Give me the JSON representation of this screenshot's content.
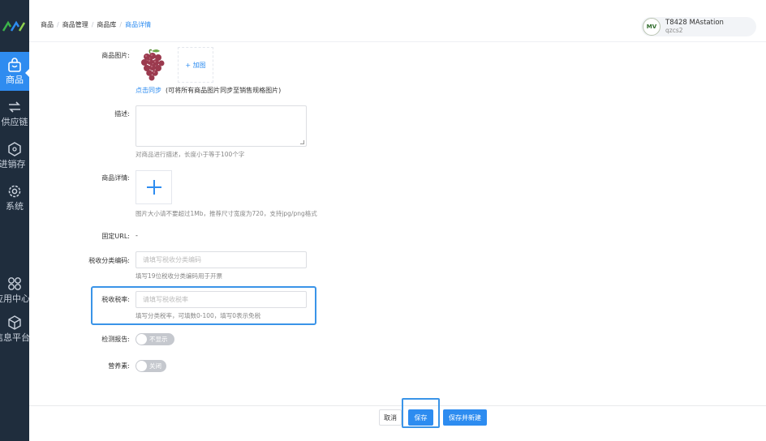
{
  "sidebar": {
    "items": [
      {
        "label": "商品",
        "icon": "bag-icon",
        "active": true
      },
      {
        "label": "供应链",
        "icon": "supply-chain-icon",
        "active": false
      },
      {
        "label": "进销存",
        "icon": "inventory-icon",
        "active": false
      },
      {
        "label": "系统",
        "icon": "gear-icon",
        "active": false
      },
      {
        "label": "应用中心",
        "icon": "apps-icon",
        "active": false
      },
      {
        "label": "信息平台",
        "icon": "cube-icon",
        "active": false
      }
    ]
  },
  "breadcrumb": [
    "商品",
    "商品管理",
    "商品库",
    "商品详情"
  ],
  "user": {
    "avatar_text": "MV",
    "name": "T8428 MAstation",
    "sub": "qzcs2"
  },
  "form": {
    "product_image": {
      "label": "商品图片:",
      "add_label": "+ 加图",
      "sync_link": "点击同步",
      "sync_note": "(可将所有商品图片同步至销售规格图片)"
    },
    "description": {
      "label": "描述:",
      "value": "",
      "hint": "对商品进行描述，长度小于等于100个字"
    },
    "detail": {
      "label": "商品详情:",
      "hint": "图片大小请不要超过1Mb，推荐尺寸宽度为720，支持jpg/png格式"
    },
    "fixed_url": {
      "label": "固定URL:",
      "value": "-"
    },
    "tax_code": {
      "label": "税收分类编码:",
      "placeholder": "请填写税收分类编码",
      "hint": "填写19位税收分类编码用于开票"
    },
    "tax_rate": {
      "label": "税收税率:",
      "placeholder": "请填写税收税率",
      "hint": "填写分类税率，可填数0-100，填写0表示免税"
    },
    "inspection_report": {
      "label": "检测报告:",
      "switch_text": "不显示",
      "on": false
    },
    "nutrition": {
      "label": "营养素:",
      "switch_text": "关闭",
      "on": false
    }
  },
  "footer": {
    "cancel": "取消",
    "save": "保存",
    "save_new": "保存并新建"
  },
  "colors": {
    "sidebar": "#1f2d3d",
    "accent": "#2d8cf0",
    "highlight": "#3a94e8"
  }
}
